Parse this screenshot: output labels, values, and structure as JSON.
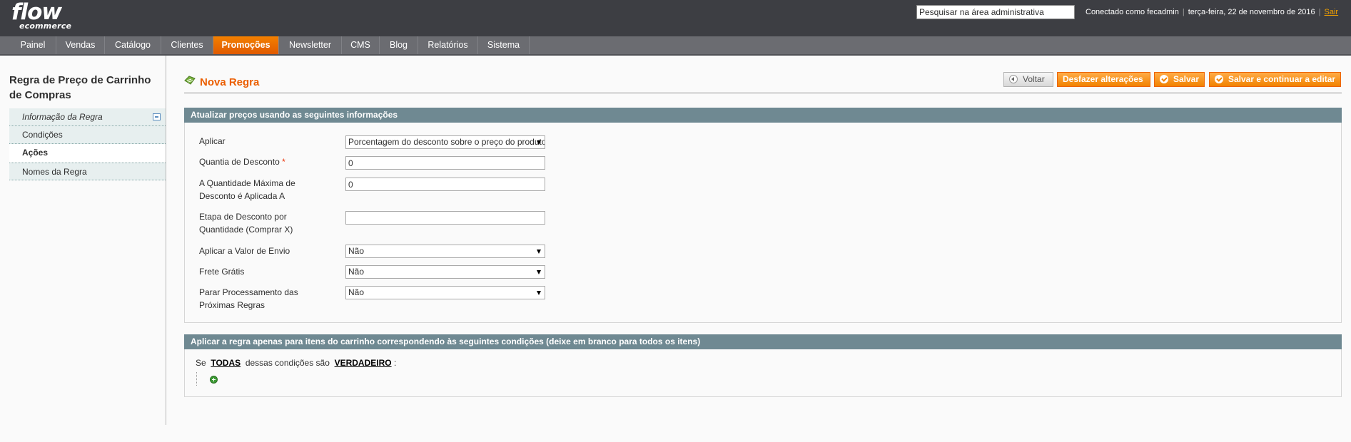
{
  "header": {
    "logo_main": "flow",
    "logo_sub": "ecommerce",
    "search_value": "Pesquisar na área administrativa",
    "logged_in": "Conectado como fecadmin",
    "date": "terça-feira, 22 de novembro de 2016",
    "logout": "Sair"
  },
  "nav": {
    "items": [
      {
        "label": "Painel"
      },
      {
        "label": "Vendas"
      },
      {
        "label": "Catálogo"
      },
      {
        "label": "Clientes"
      },
      {
        "label": "Promoções"
      },
      {
        "label": "Newsletter"
      },
      {
        "label": "CMS"
      },
      {
        "label": "Blog"
      },
      {
        "label": "Relatórios"
      },
      {
        "label": "Sistema"
      }
    ],
    "active": "Promoções"
  },
  "sidebar": {
    "title": "Regra de Preço de Carrinho de Compras",
    "tabs": [
      {
        "label": "Informação da Regra"
      },
      {
        "label": "Condições"
      },
      {
        "label": "Ações"
      },
      {
        "label": "Nomes da Regra"
      }
    ]
  },
  "page": {
    "title": "Nova Regra",
    "buttons": {
      "back": "Voltar",
      "reset": "Desfazer alterações",
      "save": "Salvar",
      "save_continue": "Salvar e continuar a editar"
    }
  },
  "actions_fieldset": {
    "heading": "Atualizar preços usando as seguintes informações",
    "fields": {
      "apply": {
        "label": "Aplicar",
        "value": "Porcentagem do desconto sobre o preço do produto"
      },
      "discount_amount": {
        "label": "Quantia de Desconto",
        "required_mark": "*",
        "value": "0"
      },
      "discount_qty": {
        "label": "A Quantidade Máxima de Desconto é Aplicada A",
        "value": "0"
      },
      "discount_step": {
        "label": "Etapa de Desconto por Quantidade (Comprar X)",
        "value": ""
      },
      "apply_shipping": {
        "label": "Aplicar a Valor de Envio",
        "value": "Não"
      },
      "free_shipping": {
        "label": "Frete Grátis",
        "value": "Não"
      },
      "stop_processing": {
        "label": "Parar Processamento das Próximas Regras",
        "value": "Não"
      }
    }
  },
  "conditions_fieldset": {
    "heading": "Aplicar a regra apenas para itens do carrinho correspondendo às seguintes condições (deixe em branco para todos os itens)",
    "prefix": "Se",
    "aggregator": "TODAS",
    "middle": "dessas condições são",
    "value": "VERDADEIRO",
    "suffix": ":"
  }
}
